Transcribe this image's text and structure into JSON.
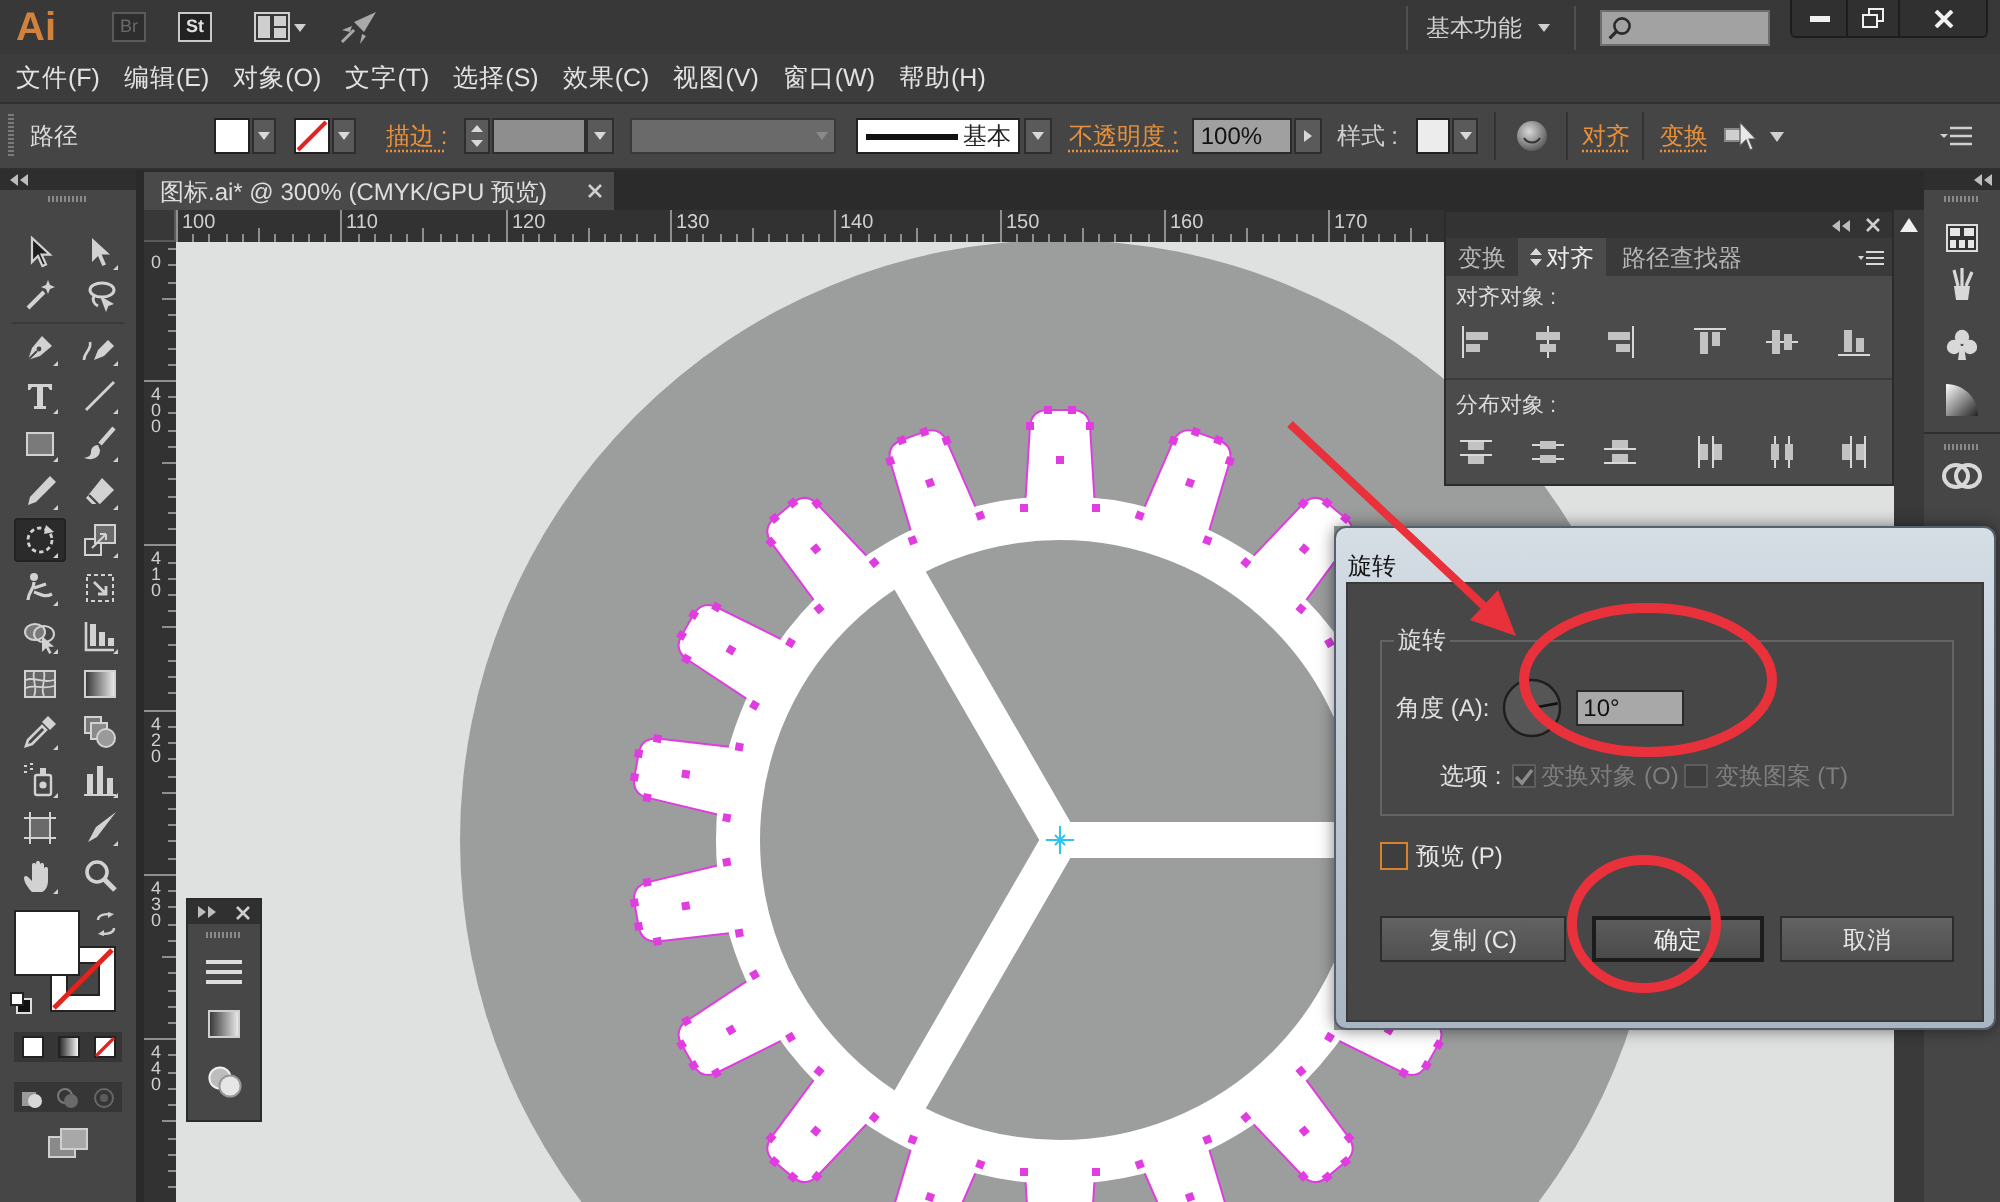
{
  "app_bar": {
    "logo": "Ai",
    "apps": [
      "Br",
      "St"
    ],
    "workspace": "基本功能"
  },
  "menu": [
    "文件(F)",
    "编辑(E)",
    "对象(O)",
    "文字(T)",
    "选择(S)",
    "效果(C)",
    "视图(V)",
    "窗口(W)",
    "帮助(H)"
  ],
  "control_bar": {
    "selection": "路径",
    "stroke_link": "描边 :",
    "brush": "基本",
    "opacity_link": "不透明度 :",
    "opacity": "100%",
    "style_label": "样式 :",
    "links": [
      "对齐",
      "变换"
    ]
  },
  "tools": [
    {
      "kind": "selection",
      "selected": false
    },
    {
      "kind": "direct-selection",
      "selected": false
    },
    {
      "kind": "magic-wand",
      "selected": false
    },
    {
      "kind": "lasso",
      "selected": false
    },
    {
      "kind": "pen",
      "selected": false
    },
    {
      "kind": "curvature",
      "selected": false
    },
    {
      "kind": "type",
      "selected": false
    },
    {
      "kind": "line",
      "selected": false
    },
    {
      "kind": "rectangle",
      "selected": false
    },
    {
      "kind": "paintbrush",
      "selected": false
    },
    {
      "kind": "pencil",
      "selected": false
    },
    {
      "kind": "eraser",
      "selected": false
    },
    {
      "kind": "rotate",
      "selected": true
    },
    {
      "kind": "scale",
      "selected": false
    },
    {
      "kind": "puppet-warp",
      "selected": false
    },
    {
      "kind": "free-transform",
      "selected": false
    },
    {
      "kind": "shape-builder",
      "selected": false
    },
    {
      "kind": "perspective-grid",
      "selected": false
    },
    {
      "kind": "mesh",
      "selected": false
    },
    {
      "kind": "gradient",
      "selected": false
    },
    {
      "kind": "eyedropper",
      "selected": false
    },
    {
      "kind": "blend",
      "selected": false
    },
    {
      "kind": "symbol-sprayer",
      "selected": false
    },
    {
      "kind": "column-graph",
      "selected": false
    },
    {
      "kind": "artboard",
      "selected": false
    },
    {
      "kind": "slice",
      "selected": false
    },
    {
      "kind": "hand",
      "selected": false
    },
    {
      "kind": "zoom",
      "selected": false
    }
  ],
  "document_tab": {
    "title": "图标.ai* @ 300% (CMYK/GPU 预览)"
  },
  "rulers": {
    "horizontal": [
      "100",
      "110",
      "120",
      "130",
      "140",
      "150",
      "160",
      "170"
    ],
    "vertical": [
      "0",
      "400",
      "410",
      "420",
      "430",
      "440"
    ]
  },
  "align_panel": {
    "tabs": [
      {
        "label": "变换",
        "selected": false
      },
      {
        "label": "对齐",
        "selected": true
      },
      {
        "label": "路径查找器",
        "selected": false
      }
    ],
    "sections": [
      {
        "kind": "align",
        "title": "对齐对象 :"
      },
      {
        "kind": "distribute",
        "title": "分布对象 :"
      }
    ]
  },
  "rotate_dialog": {
    "title": "旋转",
    "group_title": "旋转",
    "angle_label": "角度 (A):",
    "angle": "10°",
    "options_label": "选项 :",
    "options": [
      {
        "label": "变换对象 (O)",
        "checked": true,
        "disabled": true
      },
      {
        "label": "变换图案 (T)",
        "checked": false,
        "disabled": true
      }
    ],
    "preview": {
      "label": "预览 (P)",
      "checked": false,
      "focused": true
    },
    "buttons": [
      {
        "label": "复制 (C)",
        "default": false
      },
      {
        "label": "确定",
        "default": true
      },
      {
        "label": "取消",
        "default": false
      }
    ]
  }
}
